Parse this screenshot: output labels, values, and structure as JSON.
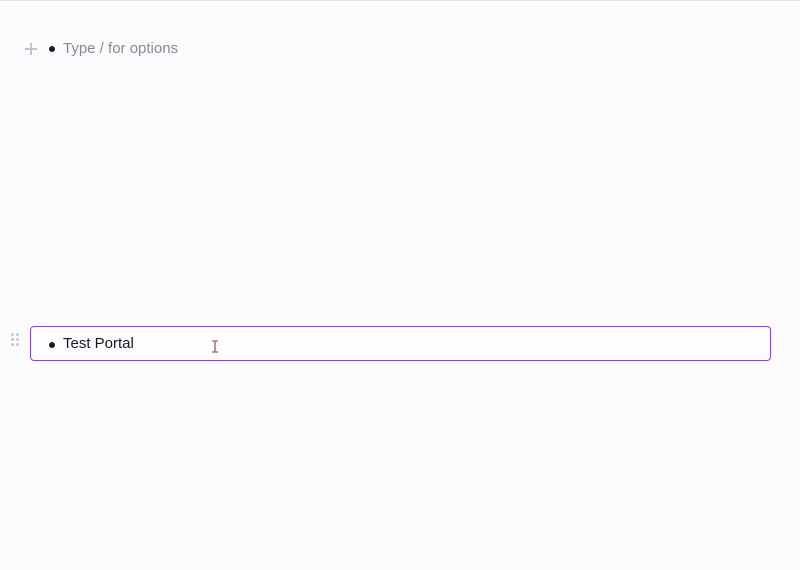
{
  "editor": {
    "empty_block": {
      "placeholder": "Type / for options",
      "add_icon": "plus-icon",
      "bullet_icon": "bullet-icon"
    },
    "selected_block": {
      "text": "Test Portal",
      "drag_icon": "drag-handle-icon",
      "bullet_icon": "bullet-icon",
      "highlight_color": "#8a45c9"
    },
    "cursor_icon": "text-cursor-icon"
  }
}
